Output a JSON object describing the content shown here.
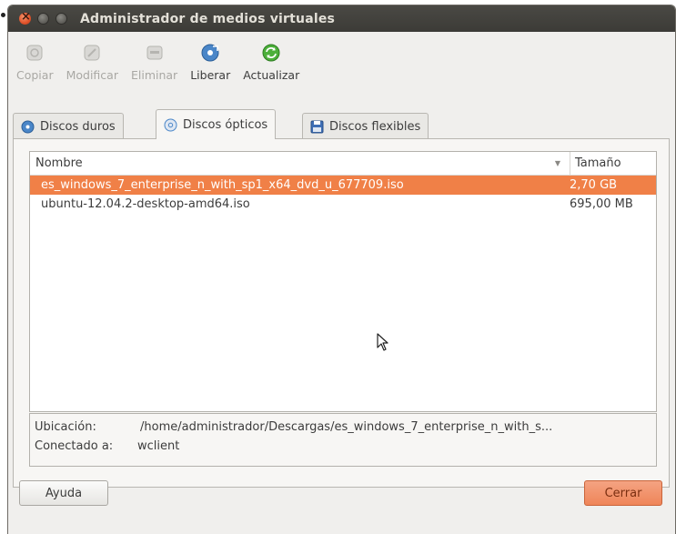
{
  "window": {
    "title": "Administrador de medios virtuales"
  },
  "toolbar": {
    "buttons": [
      {
        "label": "Copiar",
        "icon": "copy-disk-icon",
        "enabled": false
      },
      {
        "label": "Modificar",
        "icon": "modify-disk-icon",
        "enabled": false
      },
      {
        "label": "Eliminar",
        "icon": "remove-disk-icon",
        "enabled": false
      },
      {
        "label": "Liberar",
        "icon": "release-disk-icon",
        "enabled": true
      },
      {
        "label": "Actualizar",
        "icon": "refresh-icon",
        "enabled": true
      }
    ]
  },
  "tabs": [
    {
      "label": "Discos duros",
      "icon": "hard-disk-icon",
      "active": false
    },
    {
      "label": "Discos ópticos",
      "icon": "optical-disc-icon",
      "active": true
    },
    {
      "label": "Discos flexibles",
      "icon": "floppy-disk-icon",
      "active": false
    }
  ],
  "list": {
    "columns": [
      "Nombre",
      "Tamaño"
    ],
    "rows": [
      {
        "name": "es_windows_7_enterprise_n_with_sp1_x64_dvd_u_677709.iso",
        "size": "2,70 GB",
        "selected": true
      },
      {
        "name": "ubuntu-12.04.2-desktop-amd64.iso",
        "size": "695,00 MB",
        "selected": false
      }
    ]
  },
  "info": {
    "location_label": "Ubicación:",
    "location_value": "/home/administrador/Descargas/es_windows_7_enterprise_n_with_s...",
    "attached_label": "Conectado a:",
    "attached_value": "wclient"
  },
  "footer": {
    "help_label": "Ayuda",
    "close_label": "Cerrar"
  },
  "colors": {
    "selection": "#f08047",
    "titlebar": "#3c3b37",
    "close_button": "#ef8559"
  }
}
